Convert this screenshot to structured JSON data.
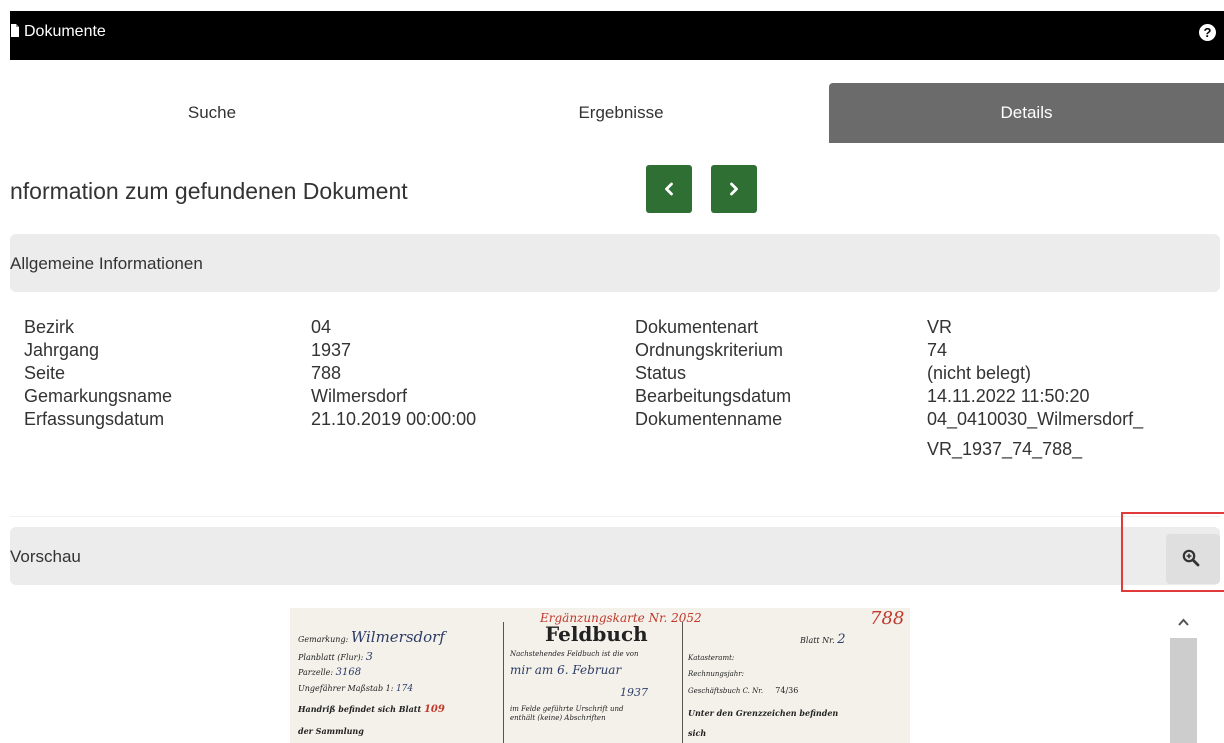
{
  "header": {
    "title": "Dokumente",
    "help_icon": "question-circle-icon",
    "doc_icon": "document-icon"
  },
  "tabs": [
    {
      "label": "Suche",
      "active": false
    },
    {
      "label": "Ergebnisse",
      "active": false
    },
    {
      "label": "Details",
      "active": true
    }
  ],
  "page": {
    "title": "nformation zum gefundenen Dokument"
  },
  "nav": {
    "prev_icon": "chevron-left-icon",
    "next_icon": "chevron-right-icon",
    "color": "#2f6f34"
  },
  "general": {
    "heading": "Allgemeine Informationen",
    "left": {
      "labels": [
        "Bezirk",
        "Jahrgang",
        "Seite",
        "Gemarkungsname",
        "Erfassungsdatum"
      ],
      "values": [
        "04",
        "1937",
        "788",
        "Wilmersdorf",
        "21.10.2019 00:00:00"
      ]
    },
    "right": {
      "labels": [
        "Dokumentenart",
        "Ordnungskriterium",
        "Status",
        "Bearbeitungsdatum",
        "Dokumentenname"
      ],
      "values": [
        "VR",
        "74",
        "(nicht belegt)",
        "14.11.2022 11:50:20",
        "04_0410030_Wilmersdorf_",
        "VR_1937_74_788_"
      ]
    }
  },
  "preview": {
    "heading": "Vorschau",
    "zoom_icon": "zoom-in-icon",
    "scroll_up_icon": "chevron-up-icon",
    "document": {
      "red_header": "Ergänzungskarte Nr. 2052",
      "red_number": "788",
      "title": "Feldbuch",
      "blatt_label": "Blatt Nr.",
      "blatt_value": "2",
      "left_lines": [
        {
          "label": "Gemarkung:",
          "value": "Wilmersdorf"
        },
        {
          "label": "Planblatt (Flur):",
          "value": "3"
        },
        {
          "label": "Parzelle:",
          "value": "3168"
        },
        {
          "label": "Ungefährer Maßstab 1:",
          "value": "174"
        },
        {
          "label": "Handriß befindet sich Blatt",
          "value": "109"
        },
        {
          "label": "der Sammlung",
          "value": ""
        }
      ],
      "mid_lines": [
        "Nachstehendes Feldbuch ist die von",
        "mir am 6. Februar",
        "1937",
        "im Felde geführte Urschrift und",
        "enthält (keine) Abschriften"
      ],
      "right_lines": [
        "Katasteramt:",
        "Rechnungsjahr:",
        "Geschäftsbuch C. Nr.",
        "Unter den Grenzzeichen befinden",
        "sich"
      ],
      "geschaeftsbuch_value": "74/36"
    }
  }
}
